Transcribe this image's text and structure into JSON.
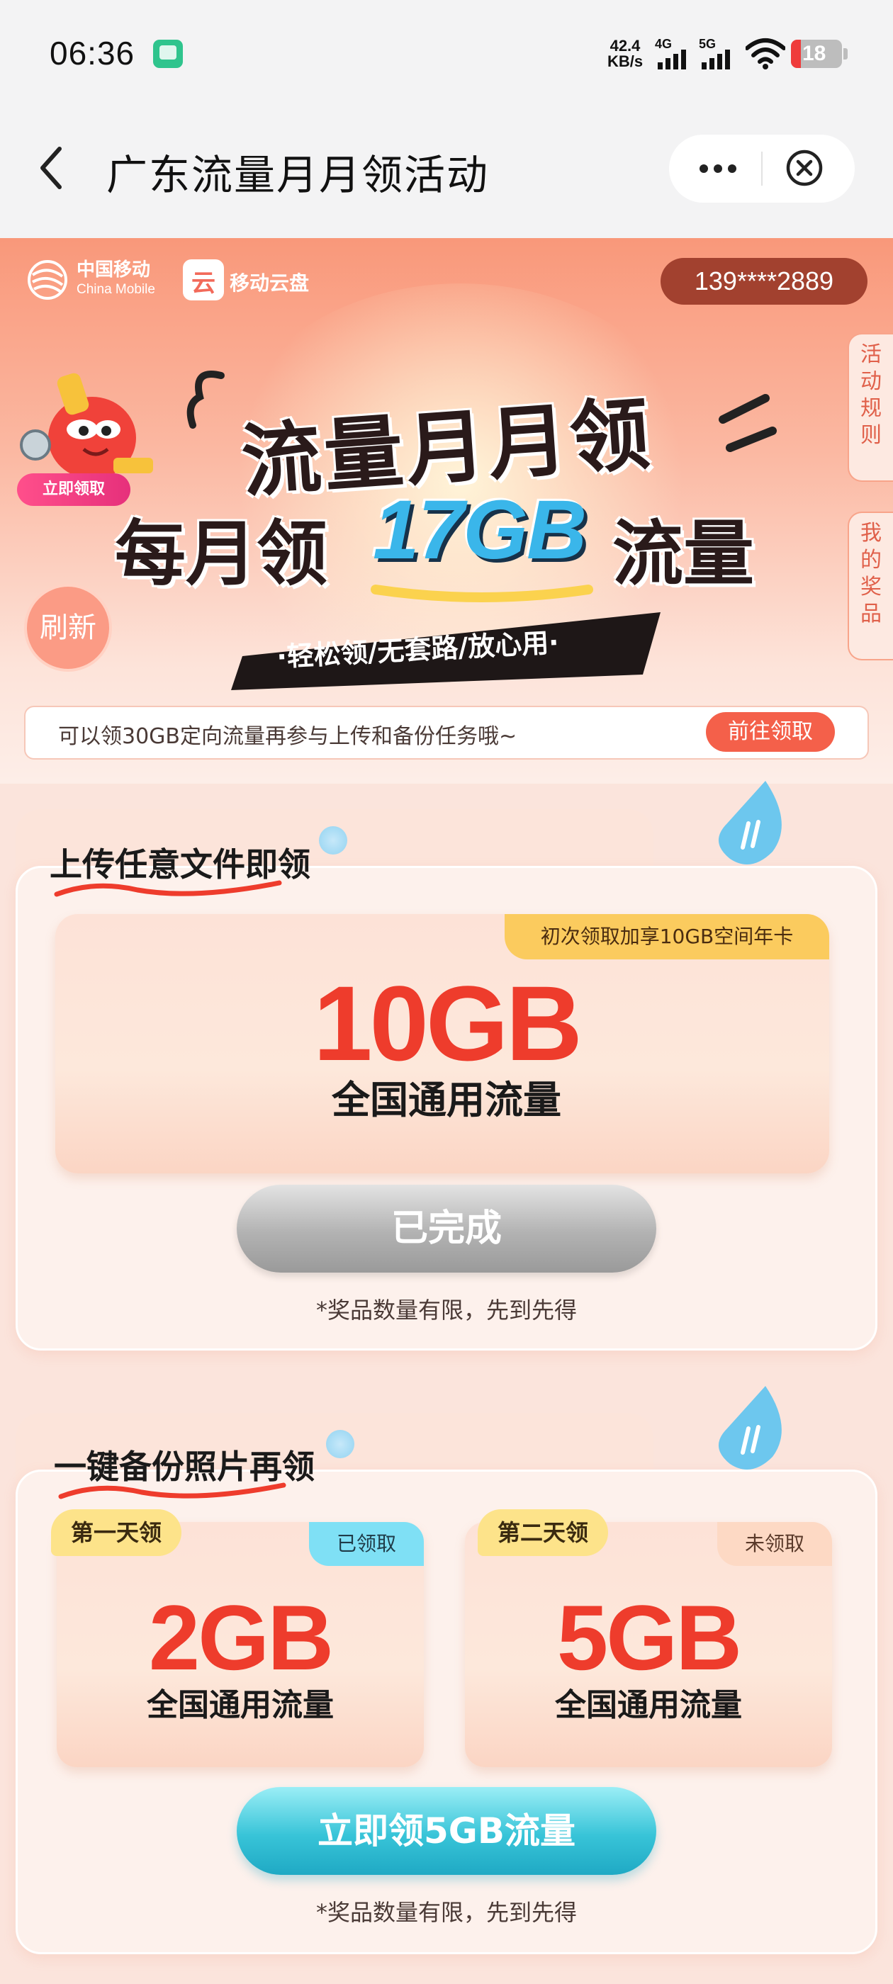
{
  "status_bar": {
    "time": "06:36",
    "net_speed_value": "42.4",
    "net_speed_unit": "KB/s",
    "signal_1_label": "4G",
    "signal_2_label": "5G",
    "battery_level": "18",
    "battery_color": "#ef3b3b"
  },
  "nav": {
    "title": "广东流量月月领活动",
    "back_icon": "chevron-left-icon",
    "more_icon": "more-dots-icon",
    "close_icon": "close-circle-icon"
  },
  "header": {
    "brand_cn": "中国移动",
    "brand_en": "China Mobile",
    "cloud_logo_char": "云",
    "cloud_name": "移动云盘",
    "phone": "139****2889"
  },
  "side_tabs": {
    "rules": "活动规则",
    "prizes": "我的奖品"
  },
  "hero": {
    "mascot_button": "立即领取",
    "refresh": "刷新",
    "headline_1": "流量月月领",
    "headline_2_pre": "每月领",
    "headline_2_num": "17GB",
    "headline_2_post": "流量",
    "slogan": "·轻松领/无套路/放心用·"
  },
  "notice": {
    "text": "可以领30GB定向流量再参与上传和备份任务哦~",
    "button": "前往领取"
  },
  "section_upload": {
    "title": "上传任意文件即领",
    "badge": "初次领取加享10GB空间年卡",
    "amount": "10GB",
    "desc": "全国通用流量",
    "button": "已完成",
    "footnote": "*奖品数量有限，先到先得"
  },
  "section_backup": {
    "title": "一键备份照片再领",
    "days": [
      {
        "label": "第一天领",
        "status": "已领取",
        "amount": "2GB",
        "desc": "全国通用流量"
      },
      {
        "label": "第二天领",
        "status": "未领取",
        "amount": "5GB",
        "desc": "全国通用流量"
      }
    ],
    "button": "立即领5GB流量",
    "footnote": "*奖品数量有限，先到先得"
  },
  "colors": {
    "accent_red": "#ee3c2c",
    "button_teal": "#38c4d8",
    "hero_coral": "#f9987a"
  }
}
